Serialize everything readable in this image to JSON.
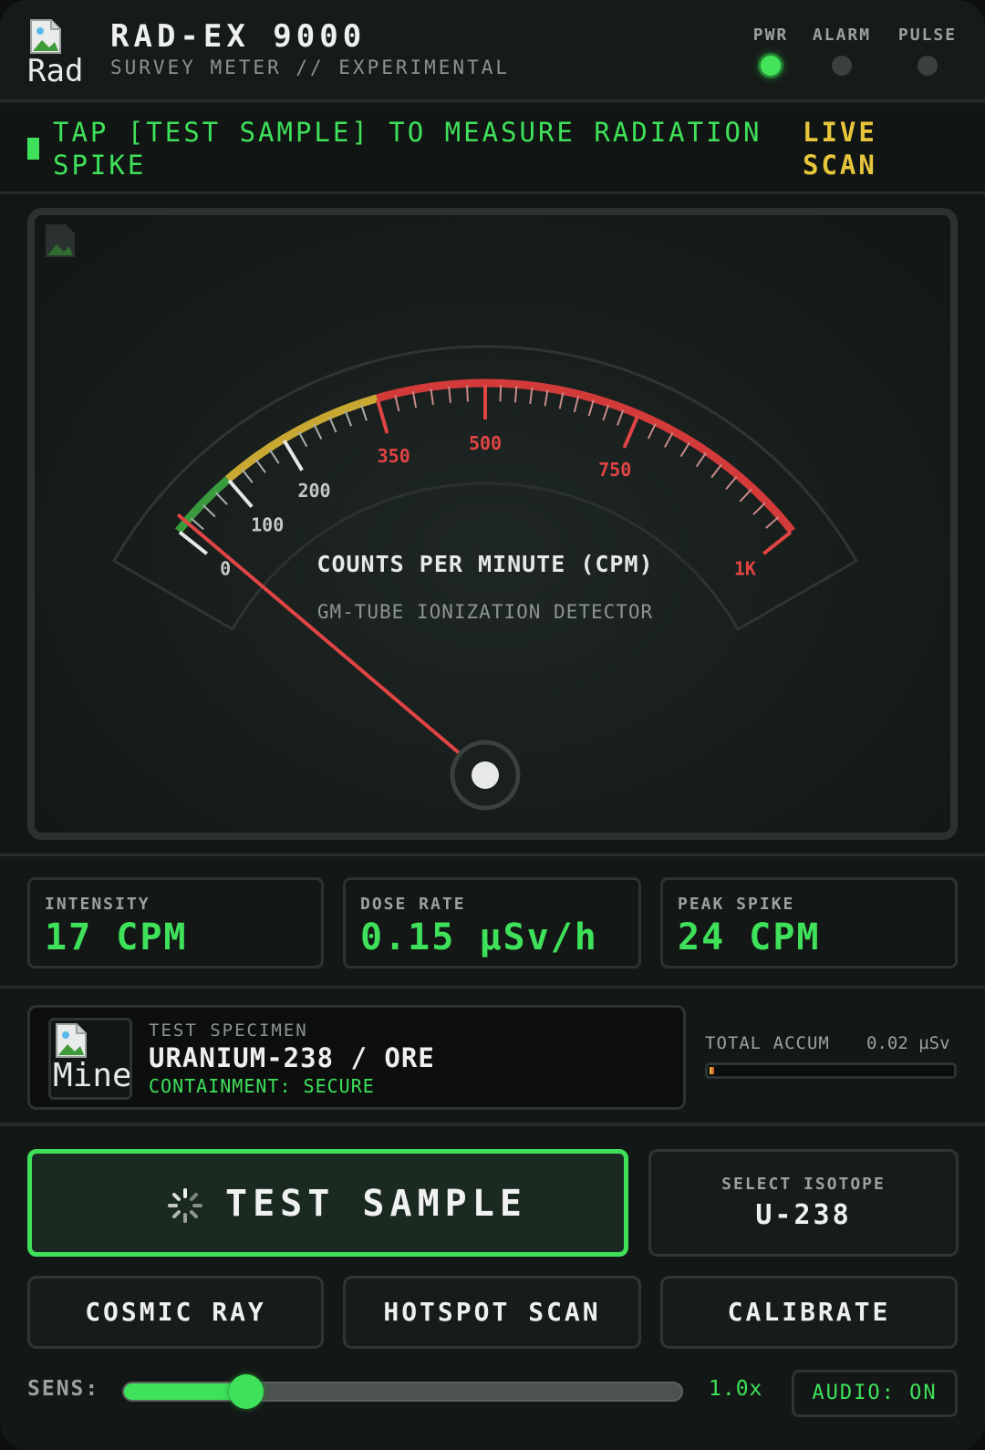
{
  "header": {
    "logo_alt": "Rad",
    "title": "RAD-EX 9000",
    "subtitle": "SURVEY METER // EXPERIMENTAL",
    "indicators": [
      {
        "label": "PWR",
        "on": true
      },
      {
        "label": "ALARM",
        "on": false
      },
      {
        "label": "PULSE",
        "on": false
      }
    ]
  },
  "banner": {
    "message": "TAP [TEST SAMPLE] TO MEASURE RADIATION SPIKE",
    "status": "LIVE SCAN"
  },
  "gauge": {
    "title": "COUNTS PER MINUTE (CPM)",
    "subtitle": "GM-TUBE IONIZATION DETECTOR",
    "scale_labels": [
      "0",
      "100",
      "200",
      "350",
      "500",
      "750",
      "1K"
    ],
    "needle_value_cpm": 17,
    "zones": [
      {
        "name": "safe",
        "color": "#3a9a3e"
      },
      {
        "name": "caution",
        "color": "#c9a832"
      },
      {
        "name": "danger",
        "color": "#d33a3a"
      }
    ]
  },
  "stats": {
    "intensity": {
      "label": "INTENSITY",
      "value": "17 CPM"
    },
    "dose_rate": {
      "label": "DOSE RATE",
      "value": "0.15 µSv/h"
    },
    "peak_spike": {
      "label": "PEAK SPIKE",
      "value": "24 CPM"
    }
  },
  "specimen": {
    "thumb_alt": "Mine",
    "label": "TEST SPECIMEN",
    "name": "URANIUM-238 / ORE",
    "containment": "CONTAINMENT: SECURE"
  },
  "accum": {
    "label": "TOTAL ACCUM",
    "value": "0.02 µSv",
    "fill_fraction": 0.02
  },
  "controls": {
    "test_label": "TEST SAMPLE",
    "isotope_label": "SELECT ISOTOPE",
    "isotope_value": "U-238",
    "buttons": [
      "COSMIC RAY",
      "HOTSPOT SCAN",
      "CALIBRATE"
    ],
    "sens_label": "SENS:",
    "sens_value": "1.0x",
    "sens_fraction": 0.22,
    "audio_label": "AUDIO: ON"
  },
  "colors": {
    "accent": "#3fe15a",
    "warning": "#e8c63c",
    "danger": "#d33a3a"
  }
}
